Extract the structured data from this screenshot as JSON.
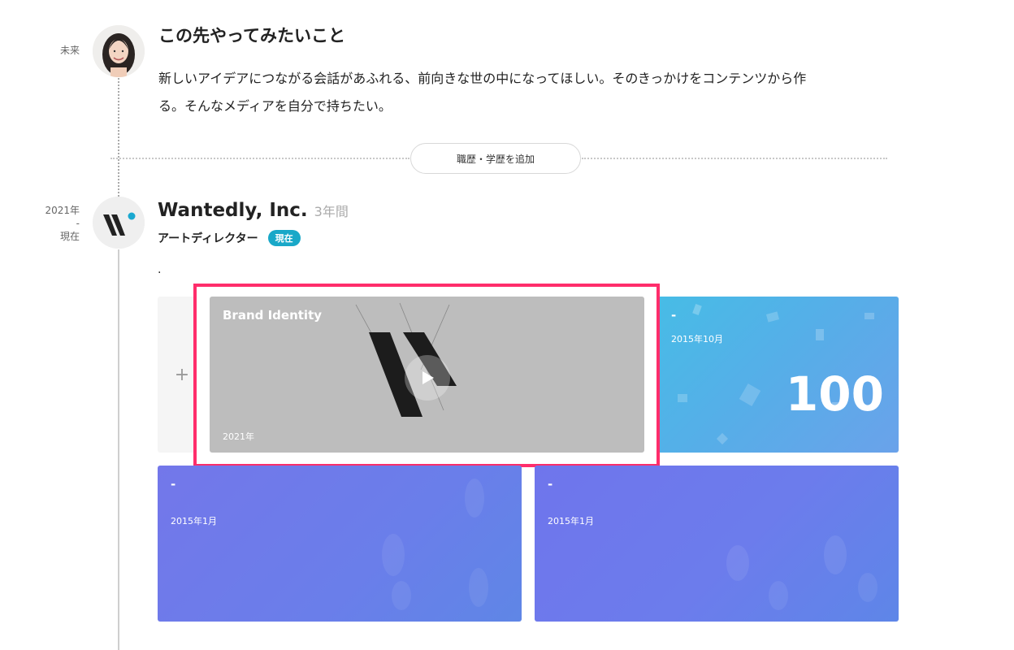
{
  "future": {
    "side_label": "未来",
    "title": "この先やってみたいこと",
    "body_line1": "新しいアイデアにつながる会話があふれる、前向きな世の中になってほしい。そのきっかけをコンテンツから作",
    "body_line2": "る。そんなメディアを自分で持ちたい。"
  },
  "add_button": {
    "label": "職歴・学歴を追加"
  },
  "job": {
    "side_from": "2021年",
    "side_dash": "-",
    "side_to": "現在",
    "company": "Wantedly, Inc.",
    "duration": "3年間",
    "role": "アートディレクター",
    "current_badge": "現在",
    "description": "."
  },
  "cards": {
    "add_card_symbol": "+",
    "featured": {
      "title": "Brand Identity",
      "date": "2021年"
    },
    "blue_card": {
      "title": "-",
      "date": "2015年10月",
      "number": "100"
    },
    "purple_left": {
      "title": "-",
      "date": "2015年1月"
    },
    "purple_right": {
      "title": "-",
      "date": "2015年1月"
    }
  },
  "colors": {
    "highlight_border": "#ff2d6b",
    "badge": "#19a8c8",
    "blue_card": "#4fb3e8",
    "purple_card": "#6a78ec"
  },
  "icons": [
    "plus-icon",
    "play-icon",
    "wantedly-logo"
  ]
}
